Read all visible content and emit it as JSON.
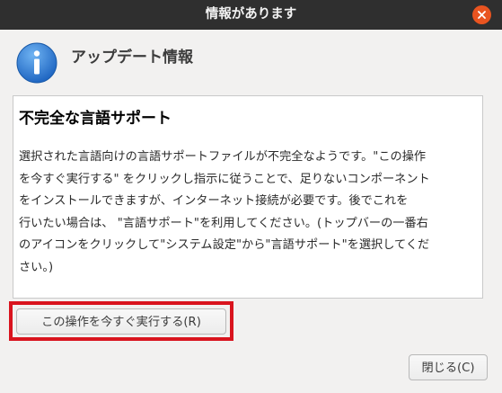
{
  "window": {
    "title": "情報があります"
  },
  "header": {
    "title": "アップデート情報",
    "icon": "info-icon"
  },
  "content": {
    "heading": "不完全な言語サポート",
    "body_lines": [
      "選択された言語向けの言語サポートファイルが不完全なようです。\"この操作",
      "を今すぐ実行する\" をクリックし指示に従うことで、足りないコンポーネント",
      "をインストールできますが、インターネット接続が必要です。後でこれを",
      "行いたい場合は、 \"言語サポート\"を利用してください。(トップバーの一番右",
      "のアイコンをクリックして\"システム設定\"から\"言語サポート\"を選択してくだ",
      "さい。)"
    ]
  },
  "buttons": {
    "run_now": "この操作を今すぐ実行する(R)",
    "close": "閉じる(C)"
  },
  "colors": {
    "titlebar": "#2f2f2f",
    "close_button": "#e95420",
    "highlight": "#d9141e",
    "info_icon": "#2f7fd6"
  }
}
